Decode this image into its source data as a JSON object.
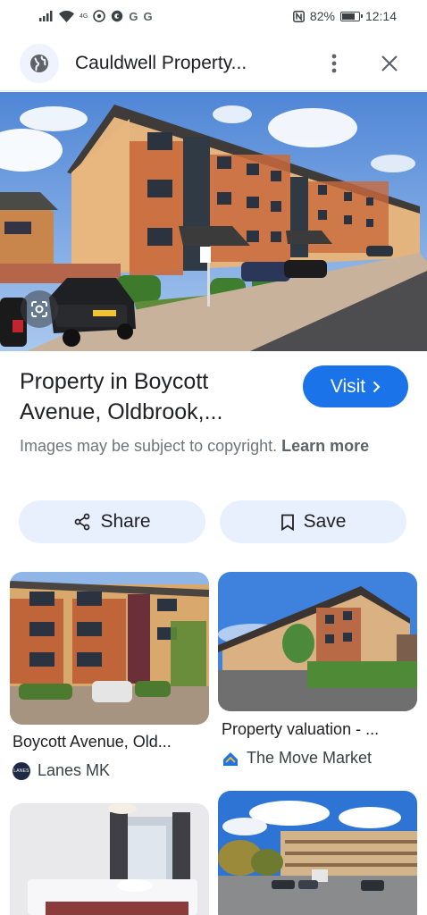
{
  "status_bar": {
    "network_label": "4G",
    "g1": "G",
    "g2": "G",
    "battery_pct": "82%",
    "battery_level": 0.82,
    "time": "12:14"
  },
  "header": {
    "title": "Cauldwell Property..."
  },
  "result": {
    "title": "Property in Boycott Avenue, Oldbrook,...",
    "visit_label": "Visit",
    "copyright_text": "Images may be subject to copyright.",
    "learn_more": "Learn more"
  },
  "actions": {
    "share_label": "Share",
    "save_label": "Save"
  },
  "related": [
    {
      "title": "Boycott Avenue, Old...",
      "source": "Lanes MK",
      "logo_text": "LANES"
    },
    {
      "title": "Property valuation - ...",
      "source": "The Move Market"
    },
    {
      "title": "",
      "source": ""
    },
    {
      "title": "",
      "source": ""
    }
  ],
  "colors": {
    "accent": "#1a73e8",
    "chip_bg": "#e8f0fe",
    "move_market_icon": "#1a73e8"
  }
}
